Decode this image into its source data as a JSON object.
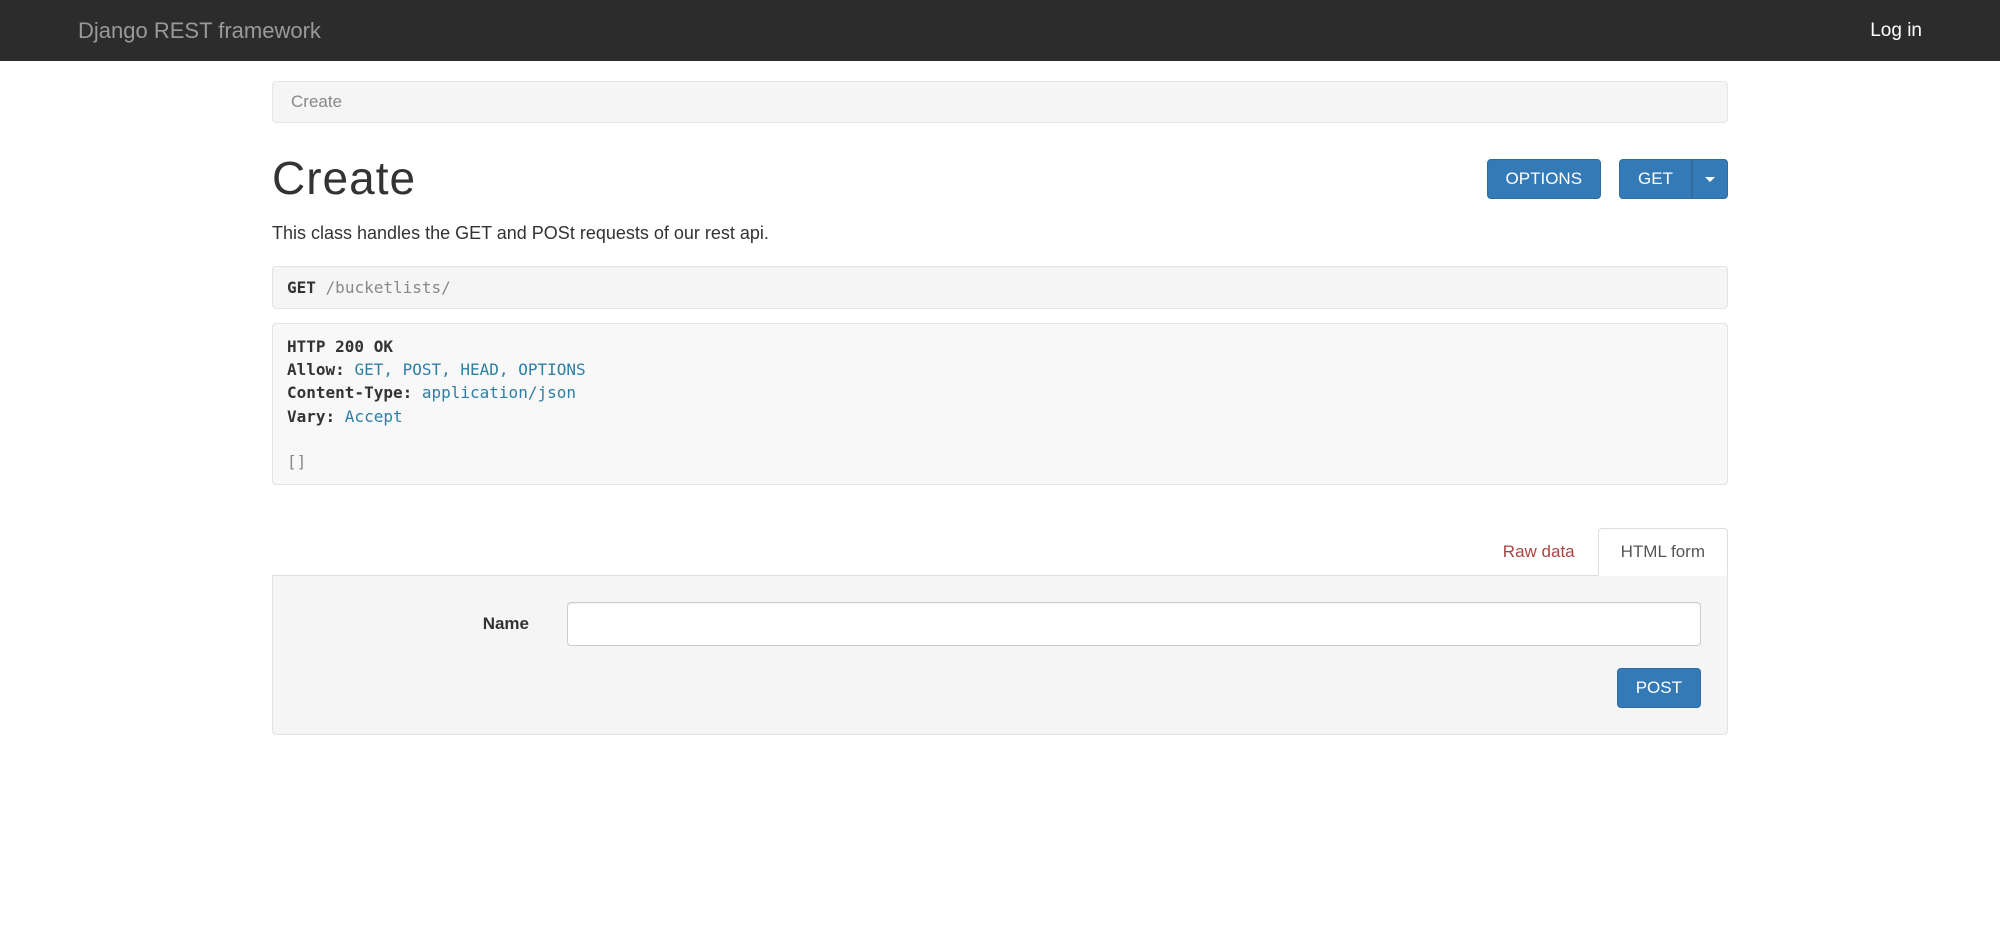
{
  "navbar": {
    "brand": "Django REST framework",
    "login": "Log in"
  },
  "breadcrumb": {
    "current": "Create"
  },
  "header": {
    "title": "Create",
    "options_label": "OPTIONS",
    "get_label": "GET"
  },
  "description": "This class handles the GET and POSt requests of our rest api.",
  "request": {
    "method": "GET",
    "path": "/bucketlists/"
  },
  "response": {
    "status_line": "HTTP 200 OK",
    "headers": [
      {
        "key": "Allow:",
        "value": "GET, POST, HEAD, OPTIONS"
      },
      {
        "key": "Content-Type:",
        "value": "application/json"
      },
      {
        "key": "Vary:",
        "value": "Accept"
      }
    ],
    "body": "[]"
  },
  "tabs": {
    "raw": "Raw data",
    "html": "HTML form"
  },
  "form": {
    "name_label": "Name",
    "name_value": "",
    "post_label": "POST"
  }
}
